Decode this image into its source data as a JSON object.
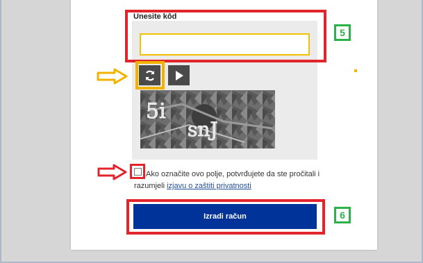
{
  "form": {
    "code_label": "Unesite kôd",
    "code_value": "",
    "consent_text": "Ako označite ovo polje, potvrđujete da ste pročitali i razumjeli",
    "privacy_link": "izjavu o zaštiti privatnosti",
    "submit_label": "Izradi račun",
    "checkbox_checked": false
  },
  "captcha": {
    "refresh_icon": "refresh-icon",
    "play_icon": "play-icon",
    "image_text": "5i snJ"
  },
  "annotations": {
    "step_5": "5",
    "step_6": "6"
  },
  "colors": {
    "highlight_red": "#e2242c",
    "highlight_yellow": "#f2b300",
    "badge_green": "#2bb34a",
    "submit_blue": "#003399"
  }
}
